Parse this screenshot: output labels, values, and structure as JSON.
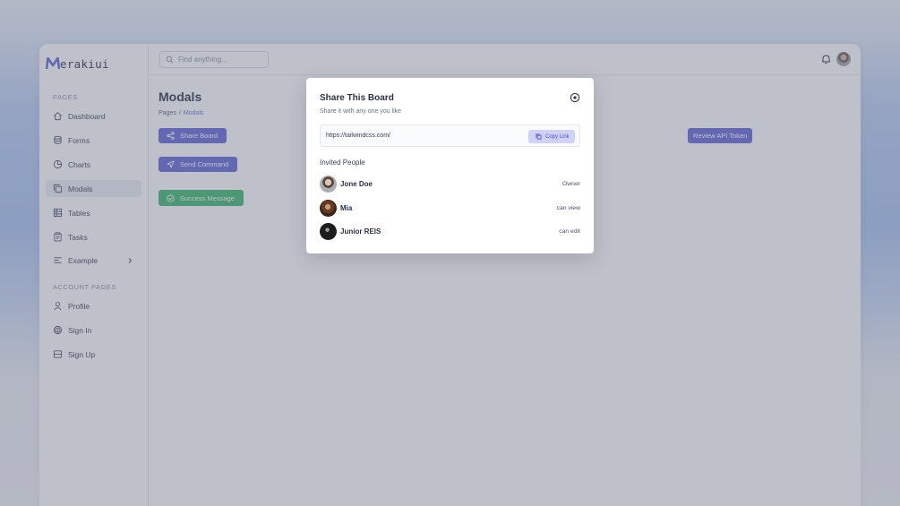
{
  "app": {
    "logo_text": "erakiui",
    "brand_color": "#6467d8"
  },
  "sidebar": {
    "pages_label": "PAGES",
    "account_label": "ACCOUNT PAGES",
    "items": [
      {
        "label": "Dashboard",
        "icon": "home-icon"
      },
      {
        "label": "Forms",
        "icon": "database-icon"
      },
      {
        "label": "Charts",
        "icon": "pie-chart-icon"
      },
      {
        "label": "Modals",
        "icon": "copy-icon",
        "active": true
      },
      {
        "label": "Tables",
        "icon": "table-icon"
      },
      {
        "label": "Tasks",
        "icon": "clipboard-icon"
      },
      {
        "label": "Example",
        "icon": "menu-lines-icon"
      }
    ],
    "account_items": [
      {
        "label": "Profile",
        "icon": "user-icon"
      },
      {
        "label": "Sign In",
        "icon": "fingerprint-icon"
      },
      {
        "label": "Sign Up",
        "icon": "form-icon"
      }
    ]
  },
  "topbar": {
    "search_placeholder": "Find anything..."
  },
  "main": {
    "title": "Modals",
    "breadcrumb": {
      "root": "Pages",
      "separator": "/",
      "current": "Modals"
    },
    "buttons": {
      "share_board": "Share Board",
      "send_command": "Send Command",
      "success_message": "Success Message",
      "review_api_token": "Review API Token"
    }
  },
  "modal": {
    "title": "Share This Board",
    "subtitle": "Share it with any one you like",
    "link_url": "https://tailwindcss.com/",
    "copy_label": "Copy Link",
    "invited_label": "Invited People",
    "people": [
      {
        "name": "Jone Doe",
        "role": "Owner"
      },
      {
        "name": "Mia",
        "role": "can view"
      },
      {
        "name": "Junior REIS",
        "role": "can edit"
      }
    ]
  }
}
